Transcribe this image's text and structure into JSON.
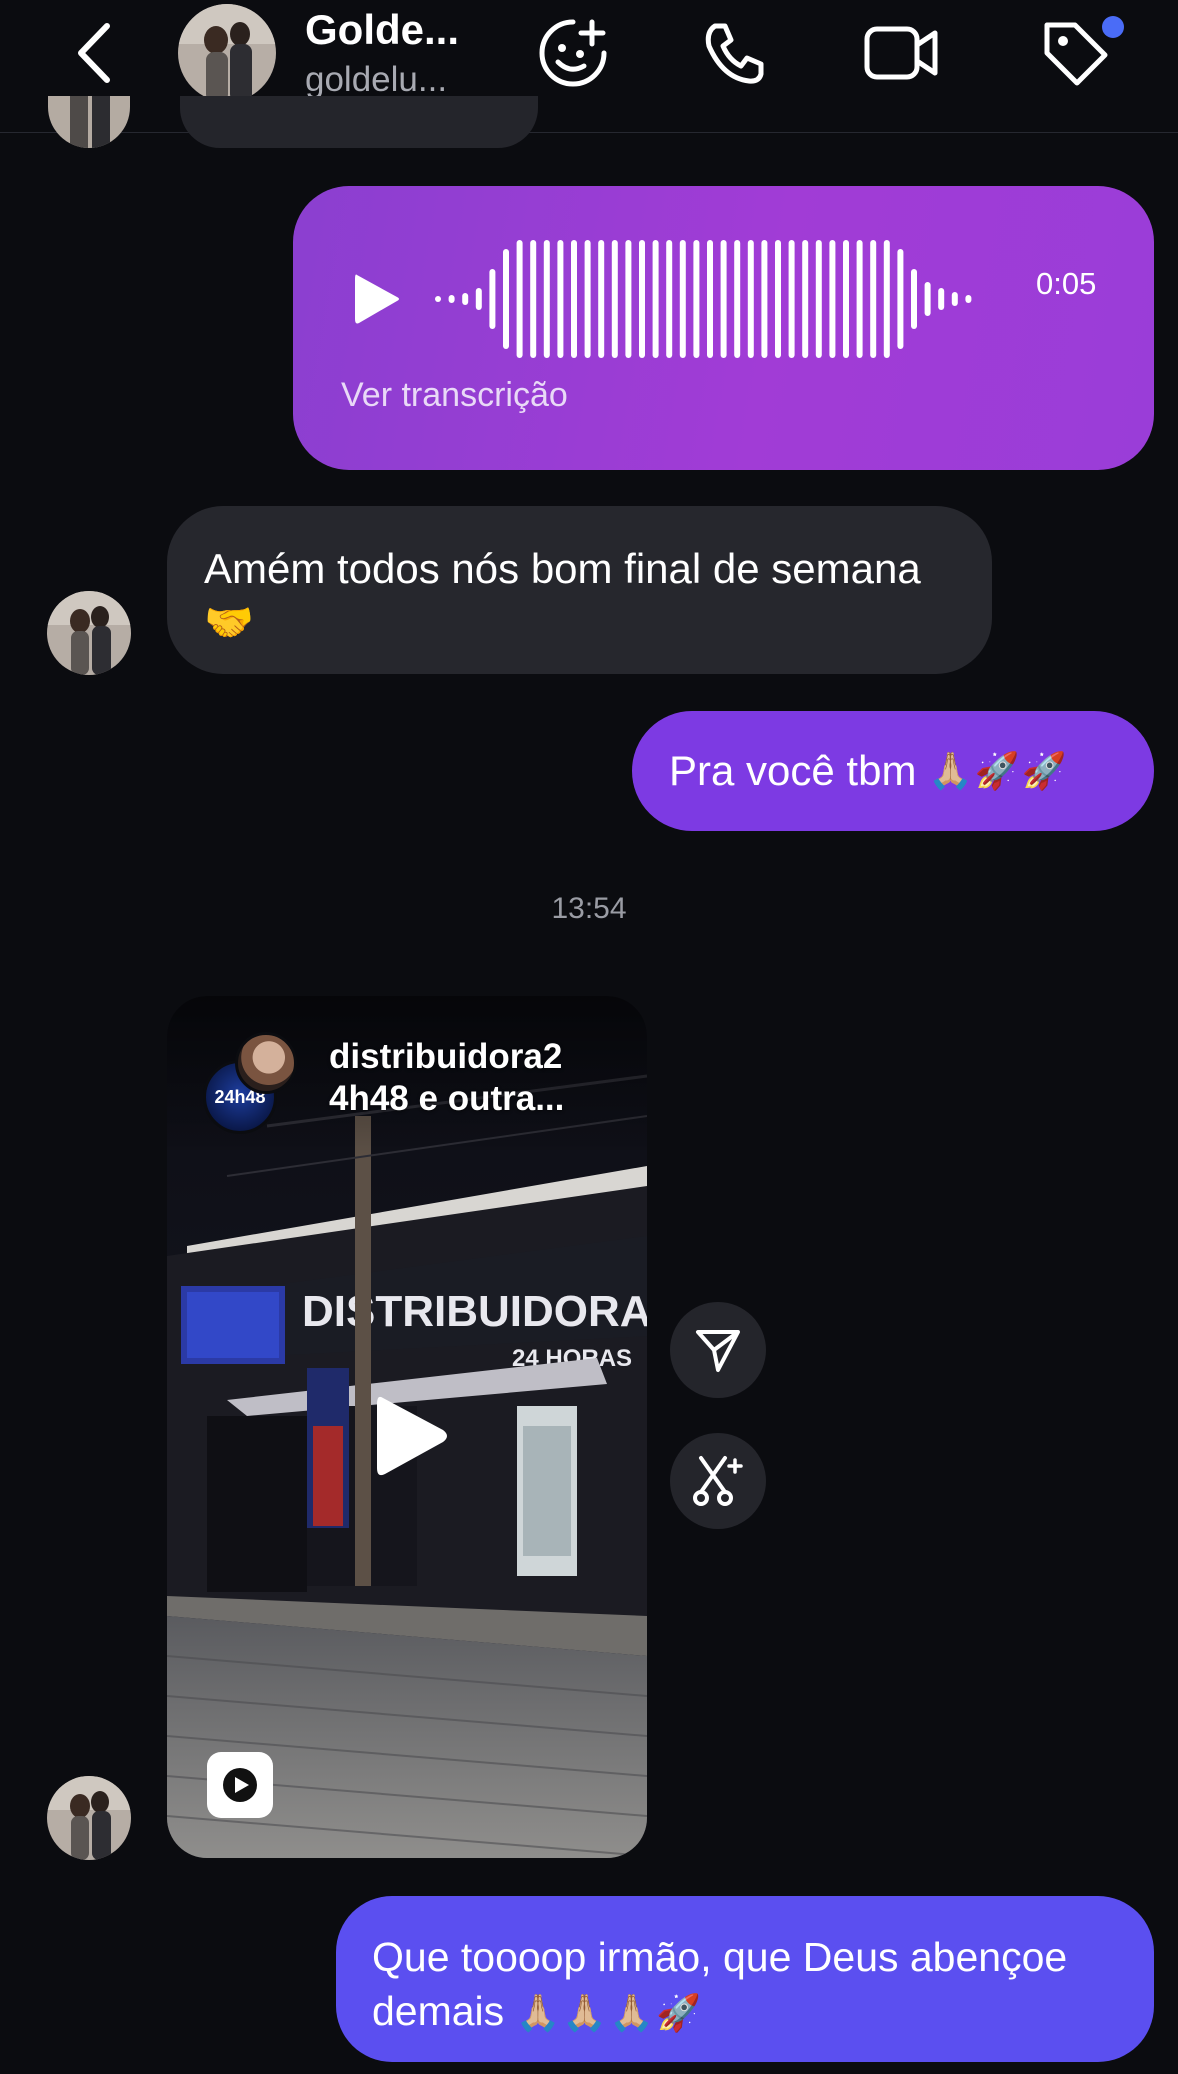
{
  "header": {
    "name": "Golde...",
    "username": "goldelu...",
    "icons": [
      "back-chevron-icon",
      "sticker-add-icon",
      "phone-icon",
      "video-camera-icon",
      "tag-icon"
    ],
    "accent_dot_color": "#4a6cf7"
  },
  "messages": {
    "voice": {
      "duration": "0:05",
      "transcript_link": "Ver transcrição",
      "color": "#9a3dd8"
    },
    "incoming_text": {
      "text": "Amém todos nós bom final de semana",
      "emoji": "🤝"
    },
    "outgoing_reply": {
      "text": "Pra você tbm",
      "emoji": "🙏🏼🚀🚀",
      "color": "#7d3ae3"
    },
    "timestamp": "13:54",
    "reel": {
      "title": "distribuidora2 4h48 e outra...",
      "logo_text": "24h48",
      "store_sign": "DISTRIBUIDORA",
      "store_hours": "24 HORAS",
      "side_buttons": [
        "share-icon",
        "remix-icon"
      ]
    },
    "outgoing_final": {
      "text": "Que toooop irmão, que Deus abençoe demais",
      "emoji": "🙏🏼🙏🏼🙏🏼🚀",
      "color": "#5b4ff0"
    }
  }
}
